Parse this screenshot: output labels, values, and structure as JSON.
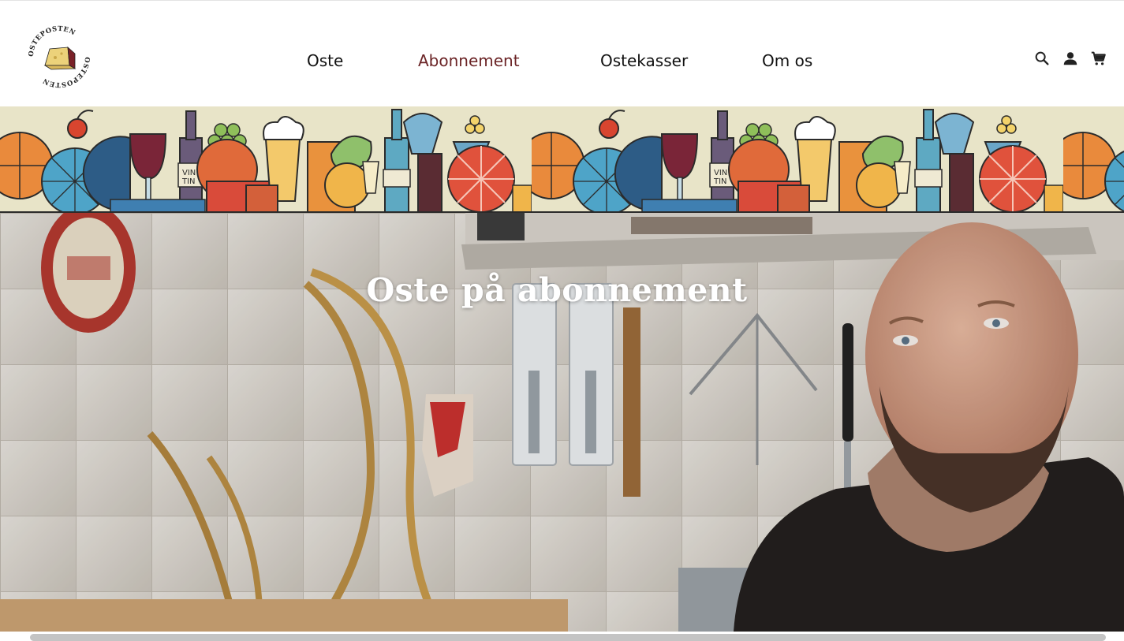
{
  "brand": {
    "logo_text": "OSTEPOSTEN",
    "logo_alt": "Osteposten logo",
    "accent_color": "#6b2426"
  },
  "nav": {
    "items": [
      {
        "label": "Oste",
        "active": false
      },
      {
        "label": "Abonnement",
        "active": true
      },
      {
        "label": "Ostekasser",
        "active": false
      },
      {
        "label": "Om os",
        "active": false
      }
    ]
  },
  "header_icons": [
    "search-icon",
    "account-icon",
    "cart-icon"
  ],
  "hero": {
    "title": "Oste på abonnement"
  }
}
